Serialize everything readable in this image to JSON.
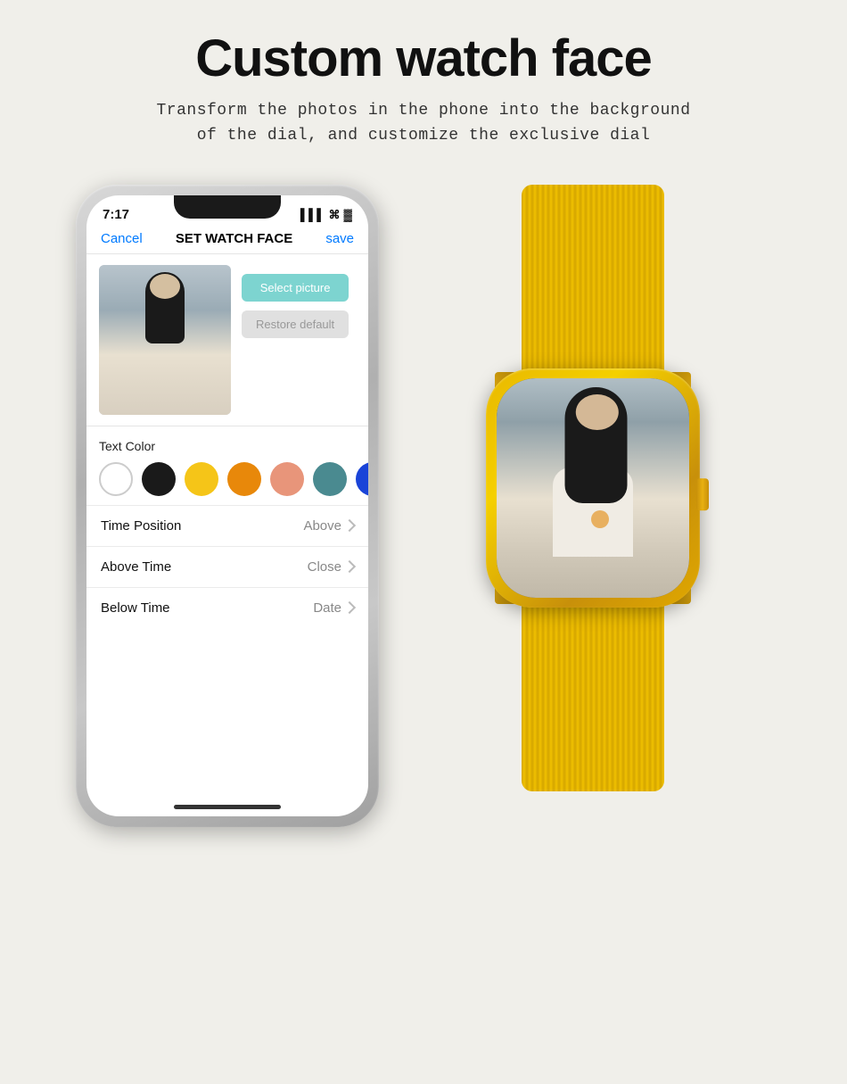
{
  "header": {
    "title": "Custom watch face",
    "subtitle_line1": "Transform the photos in the phone into the background",
    "subtitle_line2": "of the dial, and customize the exclusive dial"
  },
  "phone": {
    "status_time": "7:17",
    "nav_cancel": "Cancel",
    "nav_title": "SET WATCH FACE",
    "nav_save": "save",
    "btn_select": "Select picture",
    "btn_restore": "Restore default",
    "text_color_label": "Text Color",
    "colors": [
      "white",
      "black",
      "yellow",
      "orange",
      "peach",
      "teal",
      "blue"
    ],
    "menu_items": [
      {
        "label": "Time Position",
        "value": "Above"
      },
      {
        "label": "Above Time",
        "value": "Close"
      },
      {
        "label": "Below Time",
        "value": "Date"
      }
    ]
  }
}
